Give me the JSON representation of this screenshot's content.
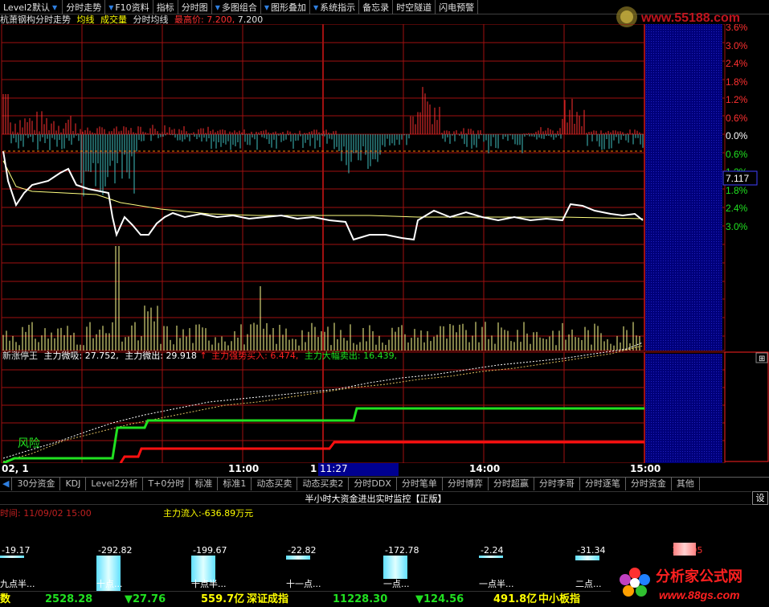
{
  "toolbar": [
    {
      "label": "Level2默认",
      "arrow": true,
      "arrow_after": true
    },
    {
      "label": "分时走势",
      "arrow": false
    },
    {
      "label": "F10资料",
      "arrow": true
    },
    {
      "label": "指标",
      "arrow": false
    },
    {
      "label": "分时图",
      "arrow": false
    },
    {
      "label": "多图组合",
      "arrow": true
    },
    {
      "label": "图形叠加",
      "arrow": true
    },
    {
      "label": "系统指示",
      "arrow": true
    },
    {
      "label": "备忘录",
      "arrow": false
    },
    {
      "label": "时空隧道",
      "arrow": false
    },
    {
      "label": "闪电预警",
      "arrow": false
    }
  ],
  "title": {
    "stock": "杭萧钢构分时走势",
    "avg_line": "均线",
    "volume": "成交量",
    "avg_price": "分时均线",
    "high_label": "最高价:",
    "high_value": "7.200,",
    "high_value2": "7.200"
  },
  "logo_text": "www.55188.com",
  "right_scale": [
    "3.6%",
    "3.0%",
    "2.4%",
    "1.8%",
    "1.2%",
    "0.6%",
    "0.0%",
    "0.6%",
    "1.2%",
    "1.8%",
    "2.4%",
    "3.0%"
  ],
  "current_price": "7.117",
  "indicator": {
    "name": "新涨停王",
    "absorb_label": "主力微吸:",
    "absorb_value": "27.752,",
    "out_label": "主力微出:",
    "out_value": "29.918",
    "strong_buy_label": "主力强势买入:",
    "strong_buy_value": "6.474,",
    "big_sell_label": "主力大幅卖出:",
    "big_sell_value": "16.439,",
    "risk_label": "风险"
  },
  "time_axis": {
    "left": "02, 1",
    "t1": "11:00",
    "t1b": "1",
    "cursor": "11:27",
    "t2": "14:00",
    "t3": "15:00"
  },
  "tabs": [
    "30分资金",
    "KDJ",
    "Level2分析",
    "T+0分时",
    "标准",
    "标准1",
    "动态买卖",
    "动态买卖2",
    "分时DDX",
    "分时笔单",
    "分时博弈",
    "分时超赢",
    "分时李哥",
    "分时逐笔",
    "分时资金",
    "其他"
  ],
  "monitor": {
    "title": "半小时大资金进出实时监控【正版】",
    "set": "设",
    "time_label": "时间: 11/09/02 15:00",
    "inflow": "主力流入:-636.89万元",
    "bars": [
      {
        "value": "-19.17",
        "label": "九点半..."
      },
      {
        "value": "-292.82",
        "label": "十点..."
      },
      {
        "value": "-199.67",
        "label": "十点半..."
      },
      {
        "value": "-22.82",
        "label": "十一点..."
      },
      {
        "value": "-172.78",
        "label": "一点..."
      },
      {
        "value": "-2.24",
        "label": "一点半..."
      },
      {
        "value": "-31.34",
        "label": "二点..."
      },
      {
        "value": "103.95",
        "label": ""
      }
    ],
    "bar_ratios": [
      0.07,
      1.0,
      0.69,
      0.1,
      0.6,
      0.02,
      0.12,
      0.38
    ]
  },
  "bottom": {
    "prefix": "数",
    "v1": "2528.28",
    "c1": "▼27.76",
    "amt1": "559.7亿",
    "name2": "深证成指",
    "v2": "11228.30",
    "c2": "▼124.56",
    "amt2": "491.8亿",
    "name3": "中小板指"
  },
  "brand": {
    "text": "分析家公式网",
    "url": "www.88gs.com"
  },
  "chart_data": {
    "type": "line",
    "title": "杭萧钢构分时走势",
    "high": 7.2,
    "current": 7.117,
    "series": [
      {
        "name": "分时均线",
        "values": [
          7.17,
          7.13,
          7.12,
          7.12,
          7.11,
          7.11,
          7.11,
          7.1,
          7.1,
          7.09,
          7.09,
          7.09,
          7.09,
          7.09,
          7.09,
          7.09
        ]
      }
    ]
  }
}
